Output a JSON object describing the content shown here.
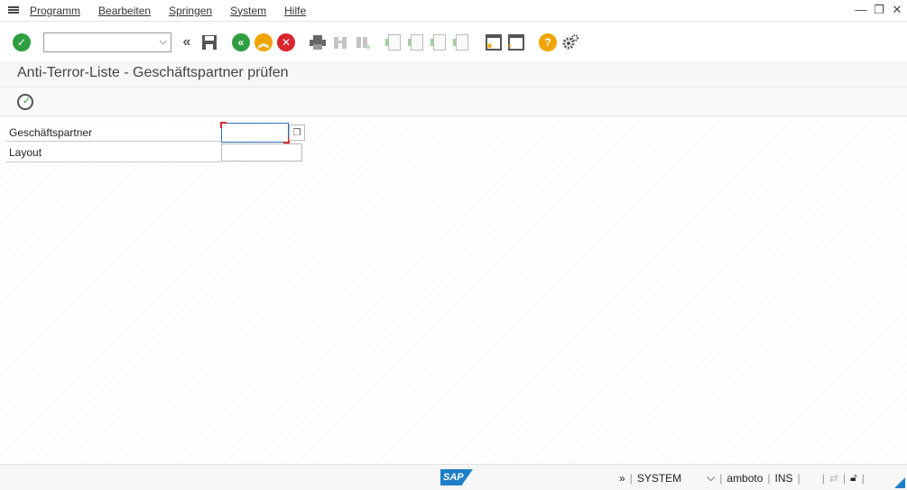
{
  "menu": {
    "items": [
      {
        "label": "Programm"
      },
      {
        "label": "Bearbeiten"
      },
      {
        "label": "Springen"
      },
      {
        "label": "System"
      },
      {
        "label": "Hilfe"
      }
    ]
  },
  "window_controls": {
    "minimize": "—",
    "restore": "❐",
    "close": "✕"
  },
  "toolbar": {
    "command_field_value": "",
    "icons": [
      "enter-icon",
      "command-field",
      "expand-icon",
      "save-icon",
      "back-icon",
      "exit-icon",
      "cancel-icon",
      "print-icon",
      "find-icon",
      "find-next-icon",
      "first-page-icon",
      "previous-page-icon",
      "next-page-icon",
      "last-page-icon",
      "new-session-icon",
      "create-shortcut-icon",
      "help-icon",
      "customize-layout-icon"
    ]
  },
  "title": "Anti-Terror-Liste - Geschäftspartner prüfen",
  "selection": {
    "fields": [
      {
        "label": "Geschäftspartner",
        "value": ""
      },
      {
        "label": "Layout",
        "value": ""
      }
    ]
  },
  "status": {
    "expand": "»",
    "system": "SYSTEM",
    "user": "amboto",
    "mode": "INS",
    "logo": "SAP"
  },
  "colors": {
    "accent": "#1e7fc8",
    "green": "#2f9e41",
    "orange": "#f0a400",
    "red": "#d9252c"
  }
}
